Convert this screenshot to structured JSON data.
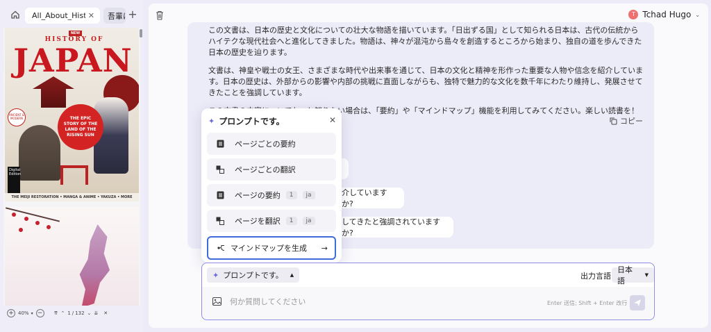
{
  "left": {
    "tabs": [
      {
        "label": "All_About_Hist…",
        "active": true
      },
      {
        "label": "吾輩は",
        "active": false
      }
    ],
    "cover": {
      "new_tag": "NEW",
      "history_of": "HISTORY OF",
      "japan": "JAPAN",
      "circle_text": "THE EPIC STORY OF THE LAND OF THE RISING SUN",
      "badge_text": "ANCIENT & MODERN",
      "digital": "Digital Edition",
      "footer": "THE MEIJI RESTORATION • MANGA & ANIME • YAKUZA • MORE"
    },
    "toolbar": {
      "zoom": "40%",
      "page_current": "1",
      "page_total": "132"
    }
  },
  "main": {
    "user": {
      "initial": "T",
      "name": "Tchad Hugo"
    },
    "bubble": {
      "paragraphs": [
        "この文書は、日本の歴史と文化についての壮大な物語を描いています。「日出ずる国」として知られる日本は、古代の伝統からハイテクな現代社会へと進化してきました。物語は、神々が混沌から島々を創造するところから始まり、独自の道を歩んできた日本の歴史を辿ります。",
        "文書は、神皇や戦士の女王、さまざまな時代や出来事を通じて、日本の文化と精神を形作った重要な人物や信念を紹介しています。日本の歴史は、外部からの影響や内部の挑戦に直面しながらも、独特で魅力的な文化を数千年にわたり維持し、発展させてきたことを強調しています。",
        "この文書の内容についてもっと知りたい場合は、「要約」や「マインドマップ」機能を利用してみてください。楽しい読書を！"
      ],
      "copy_label": "コピー",
      "questions": [
        "介していますか?",
        "してきたと強調されていますか?"
      ]
    },
    "popup": {
      "title": "プロンプトです。",
      "items": [
        {
          "label": "ページごとの要約",
          "tags": []
        },
        {
          "label": "ページごとの翻訳",
          "tags": []
        },
        {
          "label": "ページの要約",
          "tags": [
            "1",
            "ja"
          ]
        },
        {
          "label": "ページを翻訳",
          "tags": [
            "1",
            "ja"
          ]
        },
        {
          "label": "マインドマップを生成",
          "tags": [],
          "selected": true
        }
      ]
    },
    "input": {
      "prompt_button": "プロンプトです。",
      "output_lang_label": "出力言語",
      "output_lang_value": "日本語",
      "placeholder": "何か質問してください",
      "hint": "Enter 送信; Shift + Enter 改行"
    }
  }
}
